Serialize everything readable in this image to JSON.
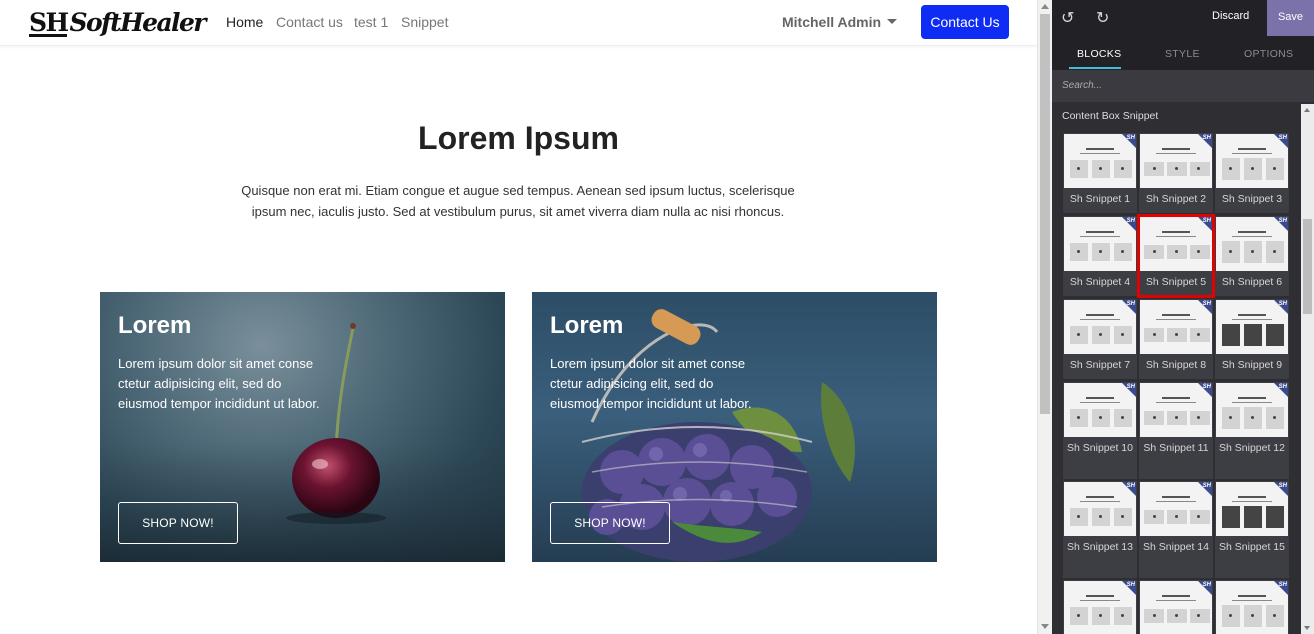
{
  "site": {
    "logo_text": "SoftHealer",
    "logo_mark": "SH",
    "nav": [
      "Home",
      "Contact us",
      "test 1",
      "Snippet"
    ],
    "user": "Mitchell Admin",
    "contact_button": "Contact Us",
    "hero": {
      "title": "Lorem Ipsum",
      "text": "Quisque non erat mi. Etiam congue et augue sed tempus. Aenean sed ipsum luctus, scelerisque ipsum nec, iaculis justo. Sed at vestibulum purus, sit amet viverra diam nulla ac nisi rhoncus."
    },
    "cards": [
      {
        "title": "Lorem",
        "text": "Lorem ipsum dolor sit amet conse ctetur adipisicing elit, sed do eiusmod tempor incididunt ut labor.",
        "button": "SHOP NOW!"
      },
      {
        "title": "Lorem",
        "text": "Lorem ipsum dolor sit amet conse ctetur adipisicing elit, sed do eiusmod tempor incididunt ut labor.",
        "button": "SHOP NOW!"
      }
    ]
  },
  "editor": {
    "undo_icon": "undo-icon",
    "redo_icon": "redo-icon",
    "discard": "Discard",
    "save": "Save",
    "tabs": [
      "BLOCKS",
      "STYLE",
      "OPTIONS"
    ],
    "active_tab": "BLOCKS",
    "search_placeholder": "Search...",
    "section_title": "Content Box Snippet",
    "snippets": [
      "Sh Snippet 1",
      "Sh Snippet 2",
      "Sh Snippet 3",
      "Sh Snippet 4",
      "Sh Snippet 5",
      "Sh Snippet 6",
      "Sh Snippet 7",
      "Sh Snippet 8",
      "Sh Snippet 9",
      "Sh Snippet 10",
      "Sh Snippet 11",
      "Sh Snippet 12",
      "Sh Snippet 13",
      "Sh Snippet 14",
      "Sh Snippet 15",
      "",
      "",
      ""
    ],
    "snippet_badge": "SH",
    "selected_snippet": "Sh Snippet 5"
  },
  "colors": {
    "accent": "#0f2cf5",
    "save_bg": "#7a72a8",
    "selected_outline": "#e30000",
    "tab_underline": "#3fbfd1"
  }
}
